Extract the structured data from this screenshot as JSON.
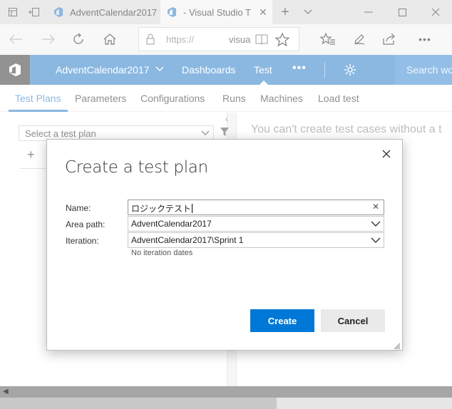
{
  "browser": {
    "tabs": [
      {
        "label": "AdventCalendar2017",
        "active": false
      },
      {
        "label": "- Visual Studio T",
        "active": true
      }
    ],
    "new_tab": "+",
    "url_prefix": "https://",
    "url_visible": "visua",
    "colors": {
      "tabbar": "#d9d9d9",
      "active_tab": "#f2f2f2"
    }
  },
  "app": {
    "project": "AdventCalendar2017",
    "nav": [
      "Dashboards",
      "Test"
    ],
    "active_nav": "Test",
    "more": "•••",
    "search_placeholder": "Search wo",
    "colors": {
      "header": "#2a7fc9",
      "logo_bg": "#3a3a3a",
      "accent": "#0078d7"
    }
  },
  "subtabs": [
    "Test Plans",
    "Parameters",
    "Configurations",
    "Runs",
    "Machines",
    "Load test"
  ],
  "active_subtab": "Test Plans",
  "left_pane": {
    "plan_select": "Select a test plan",
    "add": "+"
  },
  "main_message": "You can't create test cases without a t",
  "dialog": {
    "title": "Create a test plan",
    "name_label": "Name:",
    "name_value": "ロジックテスト",
    "area_label": "Area path:",
    "area_value": "AdventCalendar2017",
    "iteration_label": "Iteration:",
    "iteration_value": "AdventCalendar2017\\Sprint 1",
    "iteration_note": "No iteration dates",
    "create": "Create",
    "cancel": "Cancel"
  }
}
